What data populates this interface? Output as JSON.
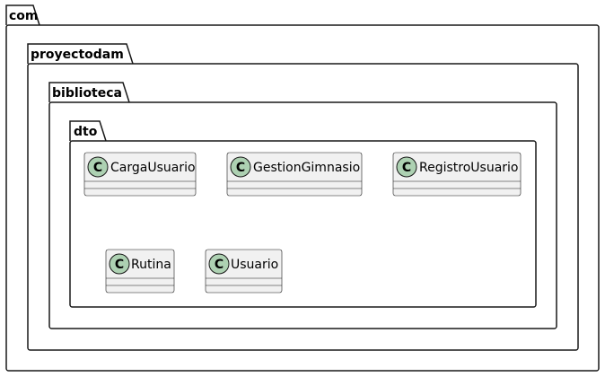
{
  "diagram": {
    "packages": [
      "com",
      "proyectodam",
      "biblioteca",
      "dto"
    ],
    "classes": [
      {
        "name": "CargaUsuario",
        "stereotype_letter": "C"
      },
      {
        "name": "GestionGimnasio",
        "stereotype_letter": "C"
      },
      {
        "name": "RegistroUsuario",
        "stereotype_letter": "C"
      },
      {
        "name": "Rutina",
        "stereotype_letter": "C"
      },
      {
        "name": "Usuario",
        "stereotype_letter": "C"
      }
    ],
    "colors": {
      "class_fill": "#f1f1f1",
      "class_icon": "#add1b2",
      "border": "#181818"
    }
  }
}
